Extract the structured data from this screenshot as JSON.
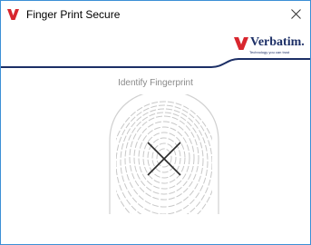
{
  "window": {
    "title": "Finger Print Secure",
    "close_glyph": "×",
    "app_icon": "verbatim-v-icon"
  },
  "brand": {
    "name": "Verbatim.",
    "tagline": "Technology you can trust",
    "colors": {
      "red": "#d8262e",
      "navy": "#1c2f66"
    }
  },
  "main": {
    "prompt": "Identify Fingerprint",
    "status_icon": "x-mark-icon"
  },
  "colors": {
    "border": "#3c8fd6",
    "fingerprint_lines": "#c8c8c8",
    "x_mark": "#2a2a2a",
    "label": "#8a8a8a"
  }
}
